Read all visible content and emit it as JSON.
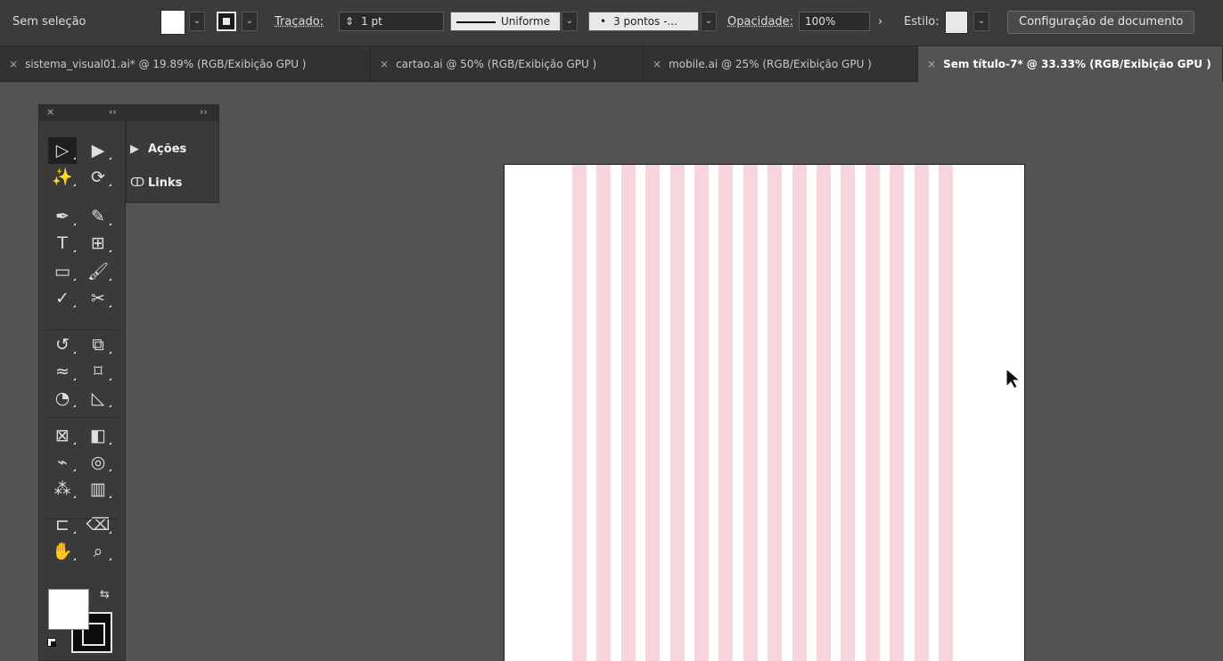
{
  "control_bar": {
    "selection_label": "Sem seleção",
    "stroke_label": "Traçado:",
    "stroke_weight": "1 pt",
    "stroke_profile": "Uniforme",
    "brush": "3 pontos -...",
    "opacity_label": "Opacidade:",
    "opacity_value": "100%",
    "style_label": "Estilo:",
    "doc_setup_button": "Configuração de documento"
  },
  "tabs": [
    {
      "label": "sistema_visual01.ai* @ 19.89% (RGB/Exibição GPU )",
      "active": false
    },
    {
      "label": "cartao.ai @ 50% (RGB/Exibição GPU )",
      "active": false
    },
    {
      "label": "mobile.ai @ 25% (RGB/Exibição GPU )",
      "active": false
    },
    {
      "label": "Sem título-7* @ 33.33% (RGB/Exibição GPU )",
      "active": true
    }
  ],
  "toolbar": {
    "tools": [
      {
        "name": "selection-tool",
        "glyph": "▷"
      },
      {
        "name": "direct-selection-tool",
        "glyph": "▶"
      },
      {
        "name": "magic-wand-tool",
        "glyph": "✨"
      },
      {
        "name": "lasso-tool",
        "glyph": "⟳"
      },
      {
        "name": "pen-tool",
        "glyph": "✒"
      },
      {
        "name": "curvature-tool",
        "glyph": "✎"
      },
      {
        "name": "type-tool",
        "glyph": "T"
      },
      {
        "name": "table-tool",
        "glyph": "⊞"
      },
      {
        "name": "rectangle-tool",
        "glyph": "▭"
      },
      {
        "name": "paintbrush-tool",
        "glyph": "🖌"
      },
      {
        "name": "shaper-tool",
        "glyph": "✓"
      },
      {
        "name": "scissors-tool",
        "glyph": "✂"
      },
      {
        "name": "rotate-tool",
        "glyph": "↺"
      },
      {
        "name": "scale-tool",
        "glyph": "⧉"
      },
      {
        "name": "width-tool",
        "glyph": "≈"
      },
      {
        "name": "free-transform-tool",
        "glyph": "⌑"
      },
      {
        "name": "shape-builder-tool",
        "glyph": "◔"
      },
      {
        "name": "perspective-grid-tool",
        "glyph": "◺"
      },
      {
        "name": "mesh-tool",
        "glyph": "⊠"
      },
      {
        "name": "gradient-tool",
        "glyph": "◧"
      },
      {
        "name": "eyedropper-tool",
        "glyph": "⌁"
      },
      {
        "name": "blend-tool",
        "glyph": "◎"
      },
      {
        "name": "symbol-sprayer-tool",
        "glyph": "⁂"
      },
      {
        "name": "column-graph-tool",
        "glyph": "▥"
      },
      {
        "name": "artboard-tool",
        "glyph": "⊏"
      },
      {
        "name": "eraser-tool",
        "glyph": "⌫"
      },
      {
        "name": "hand-tool",
        "glyph": "✋"
      },
      {
        "name": "zoom-tool",
        "glyph": "⌕"
      }
    ],
    "fill_color": "#ffffff",
    "stroke_color": "#000000"
  },
  "panel": {
    "items": [
      {
        "label": "Ações",
        "icon": "play-icon"
      },
      {
        "label": "Links",
        "icon": "link-icon"
      }
    ]
  },
  "artboard": {
    "background": "#ffffff",
    "column_color": "#f7d6db",
    "columns": 16
  }
}
